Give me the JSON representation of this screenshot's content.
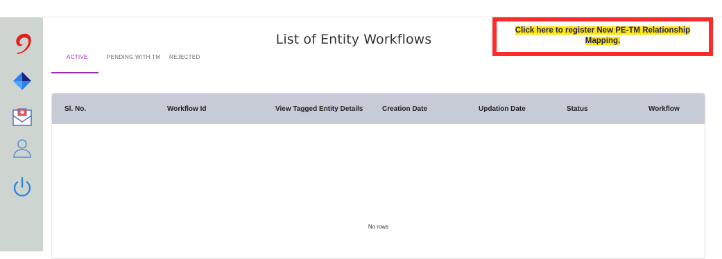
{
  "page": {
    "title": "List of Entity Workflows"
  },
  "register": {
    "line1": "Click here to register New PE-TM Relationship",
    "line2": "Mapping."
  },
  "tabs": [
    {
      "label": "ACTIVE",
      "selected": true
    },
    {
      "label": "PENDING WITH TM",
      "selected": false
    },
    {
      "label": "REJECTED",
      "selected": false
    }
  ],
  "grid": {
    "columns": [
      "Sl. No.",
      "Workflow Id",
      "View Tagged Entity Details",
      "Creation Date",
      "Updation Date",
      "Status",
      "Workflow"
    ],
    "empty_text": "No rows"
  },
  "sidebar": {
    "icons": [
      "brand-logo-icon",
      "diamond-icon",
      "mail-icon",
      "user-icon",
      "power-icon"
    ]
  },
  "colors": {
    "accent": "#9c27b0",
    "sidebar": "#ced5d1",
    "header": "#c6cbd6",
    "highlight": "#ffe600",
    "outline": "#ff2b2b"
  }
}
